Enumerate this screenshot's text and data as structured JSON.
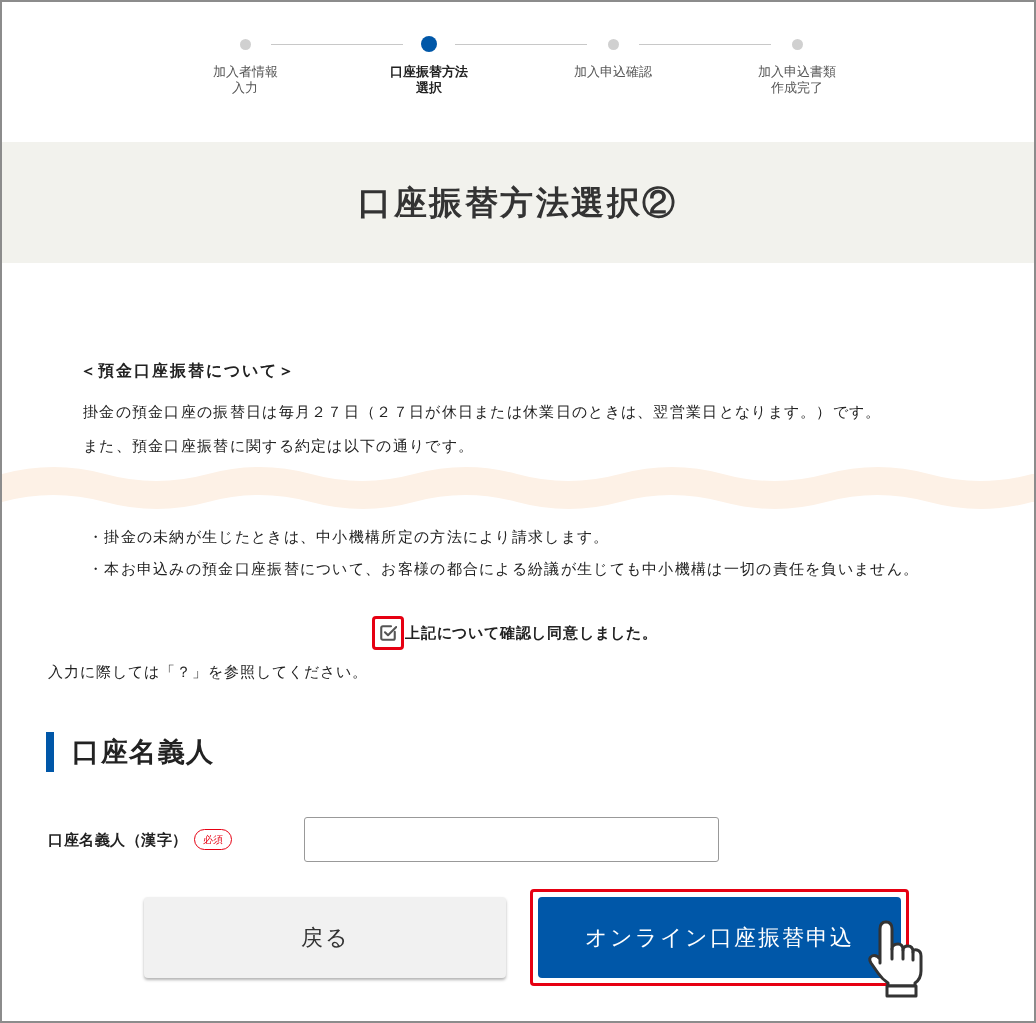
{
  "steps": [
    {
      "label_lines": [
        "加入者情報",
        "入力"
      ],
      "selected": false
    },
    {
      "label_lines": [
        "口座振替方法",
        "選択"
      ],
      "selected": true
    },
    {
      "label_lines": [
        "加入申込確認"
      ],
      "selected": false
    },
    {
      "label_lines": [
        "加入申込書類",
        "作成完了"
      ],
      "selected": false
    }
  ],
  "page_title": "口座振替方法選択②",
  "notice": {
    "heading": "＜預金口座振替について＞",
    "paragraphs": [
      "掛金の預金口座の振替日は毎月２７日（２７日が休日または休業日のときは、翌営業日となります。）です。",
      "また、預金口座振替に関する約定は以下の通りです。"
    ],
    "terms": [
      "・掛金の未納が生じたときは、中小機構所定の方法により請求します。",
      "・本お申込みの預金口座振替について、お客様の都合による紛議が生じても中小機構は一切の責任を負いません。"
    ]
  },
  "agreement": {
    "label": "上記について確認し同意しました。",
    "checked": true,
    "highlighted": true
  },
  "help_note": "入力に際しては「？」を参照してください。",
  "section": {
    "title": "口座名義人",
    "fields": [
      {
        "label": "口座名義人（漢字）",
        "badge": "必須"
      }
    ]
  },
  "buttons": [
    {
      "label": "戻る",
      "kind": "secondary",
      "highlighted": false
    },
    {
      "label": "オンライン口座振替申込",
      "kind": "primary",
      "highlighted": true
    }
  ]
}
